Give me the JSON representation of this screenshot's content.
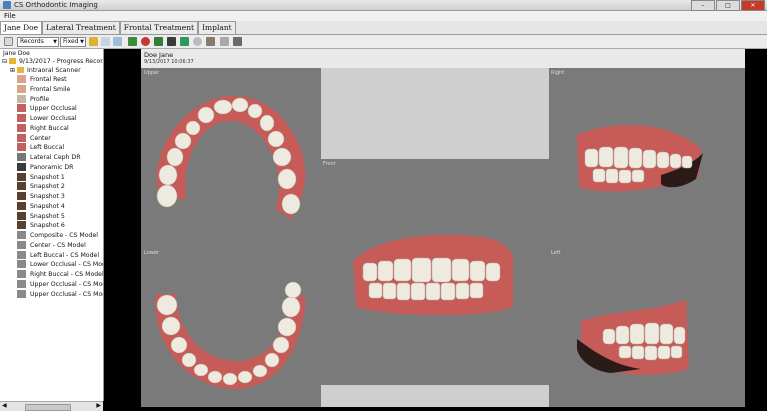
{
  "window": {
    "title": "CS Orthodontic Imaging"
  },
  "menu": {
    "file": "File"
  },
  "tabs": [
    {
      "label": "Jane Doe",
      "active": true
    },
    {
      "label": "Lateral Treatment",
      "active": false
    },
    {
      "label": "Frontal Treatment",
      "active": false
    },
    {
      "label": "Implant",
      "active": false
    }
  ],
  "toolbar": {
    "records_select": "Records",
    "layout_select": "Fixed"
  },
  "tree": {
    "root": "Jane  Doe",
    "session": "9/13/2017 - Progress Records",
    "items": [
      "Intraoral Scanner",
      "Frontal Rest",
      "Frontal Smile",
      "Profile",
      "Upper Occlusal",
      "Lower Occlusal",
      "Right Buccal",
      "Center",
      "Left Buccal",
      "Lateral Ceph DR",
      "Panoramic DR",
      "Snapshot 1",
      "Snapshot 2",
      "Snapshot 3",
      "Snapshot 4",
      "Snapshot 5",
      "Snapshot 6",
      "Composite - CS Model",
      "Center - CS Model",
      "Left Buccal - CS Model",
      "Lower Occlusal - CS Model",
      "Right Buccal - CS Model",
      "Upper Occlusal - CS Model",
      "Upper Occlusal - CS Model"
    ]
  },
  "viewer": {
    "patient_name": "Doe Jane",
    "date": "9/13/2017 10:06:37",
    "panel_labels": {
      "upper": "Upper",
      "lower": "Lower",
      "front": "Front",
      "left": "Left",
      "right": "Right"
    }
  },
  "colors": {
    "gum": "#c65b58",
    "tooth": "#eeeae0",
    "bg": "#7a7a7a",
    "tab_active": "#ffffff"
  }
}
